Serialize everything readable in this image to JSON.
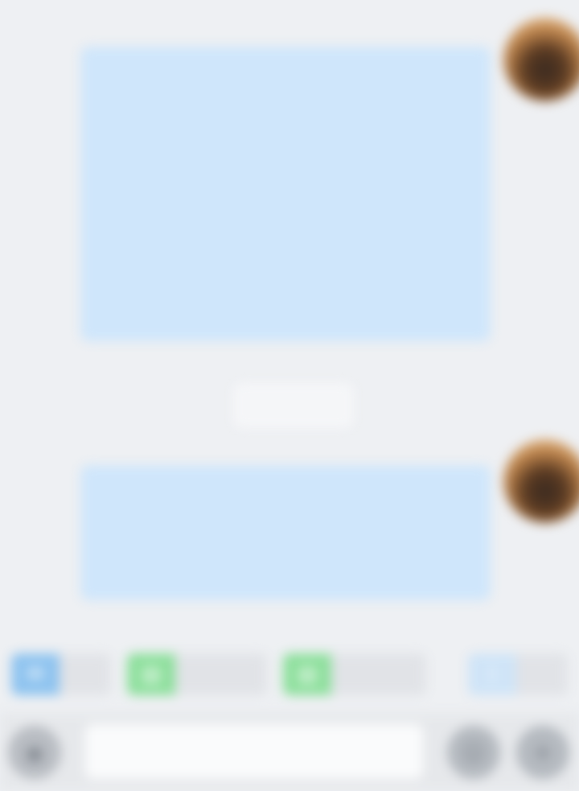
{
  "messages": [
    {
      "sender": "",
      "paragraphs": [
        "",
        ""
      ],
      "meta_line1": "",
      "meta_line2": ""
    },
    {
      "sender": "",
      "paragraphs": [
        ""
      ],
      "meta_line1": "",
      "meta_line2": ""
    }
  ],
  "divider": {
    "text": ""
  },
  "quick_actions": [
    {
      "icon": "message-icon",
      "label": "",
      "color": "#8ec3ef"
    },
    {
      "icon": "document-icon",
      "label": "",
      "color": "#8ddf9c"
    },
    {
      "icon": "document-icon",
      "label": "",
      "color": "#8ddf9c"
    },
    {
      "icon": "info-icon",
      "label": "",
      "color": "#cfe4f7"
    }
  ],
  "input_bar": {
    "placeholder": "",
    "voice_icon": "microphone-icon",
    "emoji_icon": "emoji-icon",
    "more_icon": "plus-icon"
  },
  "colors": {
    "bubble": "#cfe6fb",
    "background": "#eef0f3"
  }
}
